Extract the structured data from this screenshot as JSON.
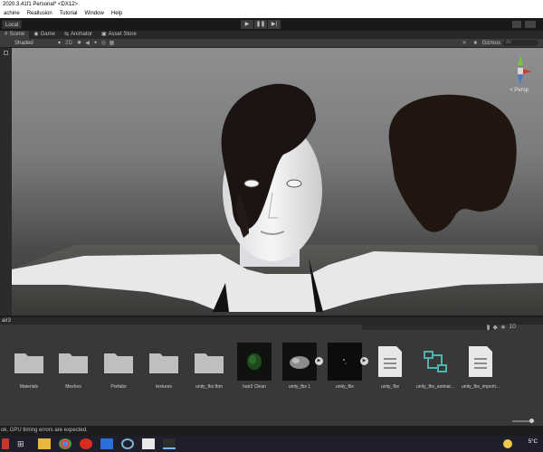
{
  "window": {
    "title": "2020.3.41f1 Personal* <DX12>"
  },
  "menu": [
    "achine",
    "Reallusion",
    "Tutorial",
    "Window",
    "Help"
  ],
  "toolbar": {
    "pivot_label": "Local",
    "play_icons": [
      "▶",
      "❚❚",
      "▶|"
    ]
  },
  "tabs": [
    {
      "label": "Scene",
      "icon": "scene-icon",
      "active": true
    },
    {
      "label": "Game",
      "icon": "game-icon",
      "active": false
    },
    {
      "label": "Animator",
      "icon": "animator-icon",
      "active": false
    },
    {
      "label": "Asset Store",
      "icon": "asset-store-icon",
      "active": false
    }
  ],
  "scene": {
    "shading_mode": "Shaded",
    "mode_2d": "2D",
    "gizmos_label": "Gizmos",
    "search_placeholder": "All",
    "projection_label": "< Persp"
  },
  "project": {
    "folder_path": "air3",
    "badge_count": "10"
  },
  "assets": [
    {
      "label": "Materials",
      "kind": "folder"
    },
    {
      "label": "Meshes",
      "kind": "folder"
    },
    {
      "label": "Prefabs",
      "kind": "folder"
    },
    {
      "label": "textures",
      "kind": "folder"
    },
    {
      "label": "unity_fbx.fbm",
      "kind": "folder"
    },
    {
      "label": "hair3 Clean",
      "kind": "preview-green"
    },
    {
      "label": "unity_fbx 1",
      "kind": "preview-model"
    },
    {
      "label": "unity_fbx",
      "kind": "preview-dark"
    },
    {
      "label": "unity_fbx",
      "kind": "doc"
    },
    {
      "label": "unity_fbx_animat...",
      "kind": "anim"
    },
    {
      "label": "unity_fbx_importi...",
      "kind": "doc"
    }
  ],
  "status": {
    "message": "ok, GPU timing errors are expected."
  },
  "taskbar": {
    "temperature": "5°C"
  },
  "colors": {
    "accent_teal": "#4fb3b0",
    "viewport_sky": "#8f8f91",
    "floor": "#3a3a38"
  }
}
